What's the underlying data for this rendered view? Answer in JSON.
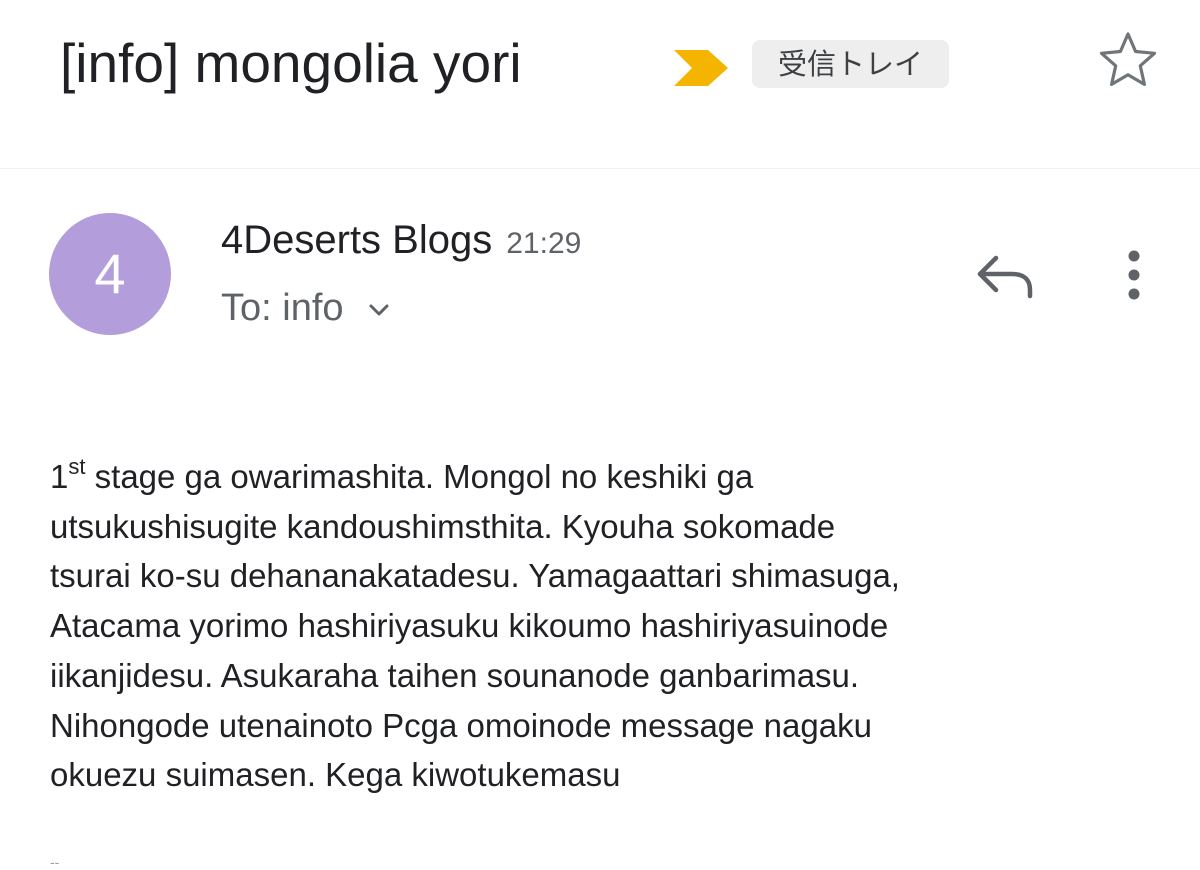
{
  "email": {
    "subject": "[info] mongolia yori",
    "label": "受信トレイ",
    "icons": {
      "importance": "importance-marker-icon",
      "star": "star-outline-icon",
      "reply": "reply-arrow-icon",
      "more": "more-vert-icon",
      "expand": "chevron-down-icon"
    },
    "colors": {
      "importance": "#f4b400",
      "avatar": "#b39ddb",
      "label_chip": "#eeeeee"
    }
  },
  "sender": {
    "avatar_letter": "4",
    "name": "4Deserts Blogs",
    "time": "21:29",
    "recipient": "To: info"
  },
  "message": {
    "first_word_number": "1",
    "first_word_suffix": "st",
    "line1_rest": " stage ga owarimashita. Mongol no keshiki ga",
    "line2": "utsukushisugite kandoushimsthita. Kyouha sokomade",
    "line3": "tsurai ko-su dehananakatadesu. Yamagaattari shimasuga,",
    "line4": "Atacama yorimo hashiriyasuku kikoumo hashiriyasuinode",
    "line5": "iikanjidesu. Asukaraha taihen sounanode ganbarimasu.",
    "line6": "Nihongode utenainoto Pcga omoinode message nagaku",
    "line7": "okuezu suimasen. Kega kiwotukemasu",
    "signature_separator": "--"
  }
}
